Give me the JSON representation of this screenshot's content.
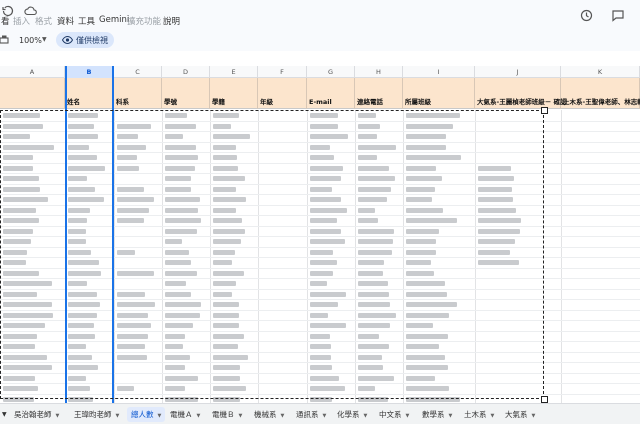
{
  "menu": {
    "items": [
      {
        "label": "看",
        "enabled": true
      },
      {
        "label": "插入",
        "enabled": false
      },
      {
        "label": "格式",
        "enabled": false
      },
      {
        "label": "資料",
        "enabled": true
      },
      {
        "label": "工具",
        "enabled": true
      },
      {
        "label": "Gemini",
        "enabled": true
      },
      {
        "label": "擴充功能",
        "enabled": false
      },
      {
        "label": "說明",
        "enabled": true
      }
    ]
  },
  "toolbar": {
    "zoom": "100%",
    "view_mode_label": "僅供檢視"
  },
  "columns": [
    "A",
    "B",
    "C",
    "D",
    "E",
    "F",
    "G",
    "H",
    "I",
    "J",
    "K"
  ],
  "selected_column": "B",
  "header_row": [
    "",
    "姓名",
    "科系",
    "學號",
    "學籍",
    "年級",
    "E-mail",
    "連絡電話",
    "所屬班級",
    "大氣系-王麗楨老師班級－ 確認",
    "土木系-王聖偉老師、林志軒"
  ],
  "sheet_tabs": [
    {
      "label": "吳治翰老師",
      "active": false
    },
    {
      "label": "王瑋昀老師",
      "active": false
    },
    {
      "label": "總人數",
      "active": true
    },
    {
      "label": "電機Ａ",
      "active": false
    },
    {
      "label": "電機Ｂ",
      "active": false
    },
    {
      "label": "機械系",
      "active": false
    },
    {
      "label": "通訊系",
      "active": false
    },
    {
      "label": "化學系",
      "active": false
    },
    {
      "label": "中文系",
      "active": false
    },
    {
      "label": "數學系",
      "active": false
    },
    {
      "label": "土木系",
      "active": false
    },
    {
      "label": "大氣系",
      "active": false
    }
  ],
  "colors": {
    "header_fill": "#fce5cd",
    "selection": "#1a73e8",
    "active_tab_text": "#0b57d0",
    "view_pill": "#dbe7fb"
  }
}
